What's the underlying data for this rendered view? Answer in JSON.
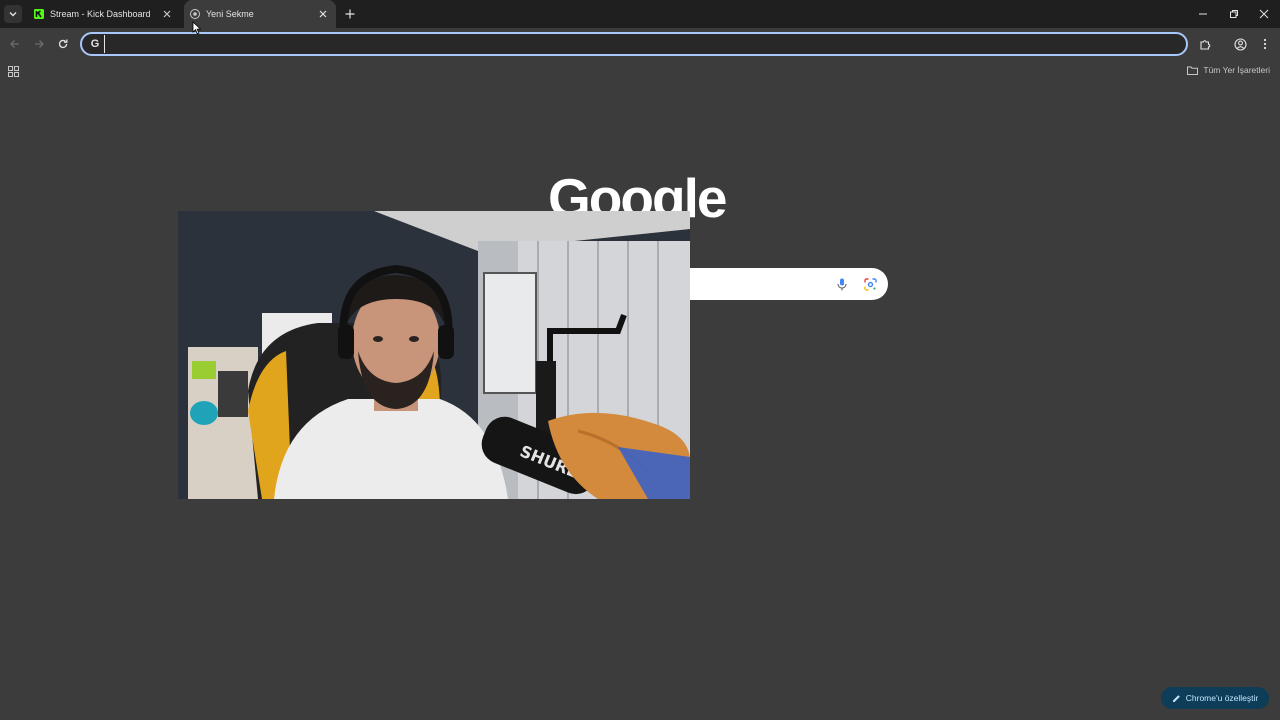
{
  "tabs": [
    {
      "title": "Stream - Kick Dashboard",
      "favicon": "kick-logo-icon",
      "active": false
    },
    {
      "title": "Yeni Sekme",
      "favicon": "chrome-icon",
      "active": true
    }
  ],
  "omnibox": {
    "value": "",
    "placeholder": ""
  },
  "bookmarks": {
    "all_bookmarks_label": "Tüm Yer İşaretleri"
  },
  "ntp": {
    "logo_text": "Google",
    "customize_label": "Chrome'u özelleştir"
  },
  "colors": {
    "tabstrip_bg": "#1f1f1f",
    "page_bg": "#3c3c3c",
    "omnibox_focus": "#a8c7fa",
    "kick_green": "#53fc18",
    "customize_bg": "#0d3d58",
    "customize_text": "#c2e7ff"
  }
}
